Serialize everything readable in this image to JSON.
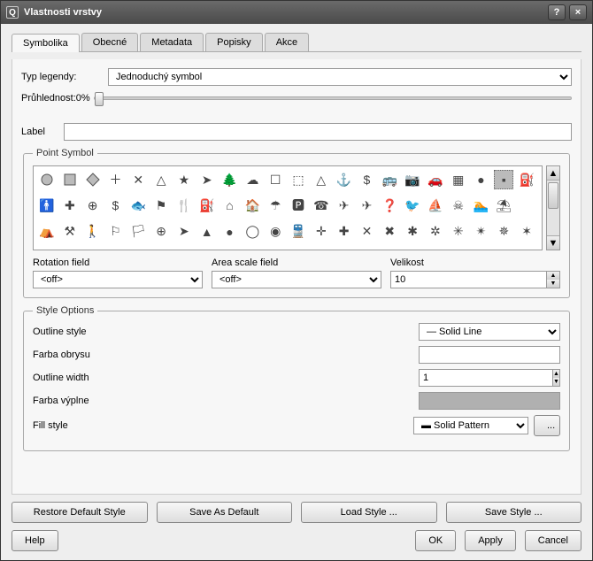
{
  "window": {
    "title": "Vlastnosti vrstvy"
  },
  "tabs": [
    "Symbolika",
    "Obecné",
    "Metadata",
    "Popisky",
    "Akce"
  ],
  "legend": {
    "label": "Typ legendy:",
    "value": "Jednoduchý symbol"
  },
  "transparency": {
    "label": "Průhlednost:0%"
  },
  "labelrow": {
    "label": "Label",
    "value": ""
  },
  "pointsymbol": {
    "title": "Point Symbol",
    "rotation_label": "Rotation field",
    "rotation_value": "<off>",
    "areascale_label": "Area scale field",
    "areascale_value": "<off>",
    "size_label": "Velikost",
    "size_value": "10"
  },
  "styleoptions": {
    "title": "Style Options",
    "outlinestyle_label": "Outline style",
    "outlinestyle_value": "— Solid Line",
    "outlinecolor_label": "Farba obrysu",
    "outlinewidth_label": "Outline width",
    "outlinewidth_value": "1",
    "fillcolor_label": "Farba výplne",
    "fillstyle_label": "Fill style",
    "fillstyle_value": "▬ Solid Pattern",
    "more": "..."
  },
  "buttons": {
    "restore": "Restore Default Style",
    "saveasdefault": "Save As Default",
    "loadstyle": "Load Style ...",
    "savestyle": "Save Style ...",
    "help": "Help",
    "ok": "OK",
    "apply": "Apply",
    "cancel": "Cancel"
  },
  "titlebar_icons": {
    "help": "?",
    "close": "×"
  }
}
